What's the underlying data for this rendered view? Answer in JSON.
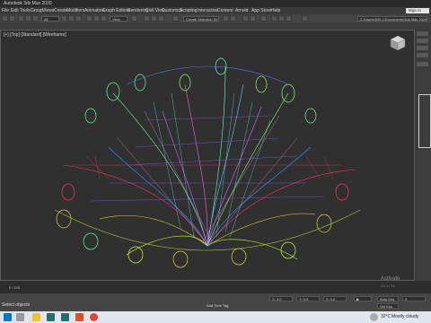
{
  "window": {
    "title": "Autodesk 3ds Max 2020"
  },
  "menubar": {
    "items": [
      "File",
      "Edit",
      "Tools",
      "Group",
      "Views",
      "Create",
      "Modifiers",
      "Animation",
      "Graph Editors",
      "Rendering",
      "Civil View",
      "Customize",
      "Scripting",
      "Interactive",
      "Content",
      "Arnold",
      "App Store",
      "Help"
    ],
    "sign_in": "Sign In"
  },
  "toolbar": {
    "filter_select": "All",
    "view_select": "View",
    "selection_set": "Create Selection Se",
    "path": "C:\\Users\\DELL\\Documents\\3ds Max 2020"
  },
  "viewport": {
    "label": "[+] [Top] [Standard] [Wireframe]"
  },
  "viewcube": {
    "label": "TOP"
  },
  "timeline": {
    "frame": "0 / 100"
  },
  "status": {
    "selection": "None Selected",
    "prompt": "Select objects",
    "x": "X: 4.0",
    "y": "Y: 5.0",
    "z": "Z: 0.0",
    "time_tag": "Add Time Tag",
    "auto": "Auto Key",
    "set_key": "Set Key",
    "frame_box": "0"
  },
  "activation": {
    "line1": "Activate",
    "line2": "Go to Se"
  },
  "taskbar": {
    "temp": "32°C",
    "weather": "Mostly cloudy"
  },
  "colors": {
    "accent": "#e6e6e6",
    "viewport_bg": "#303030"
  }
}
